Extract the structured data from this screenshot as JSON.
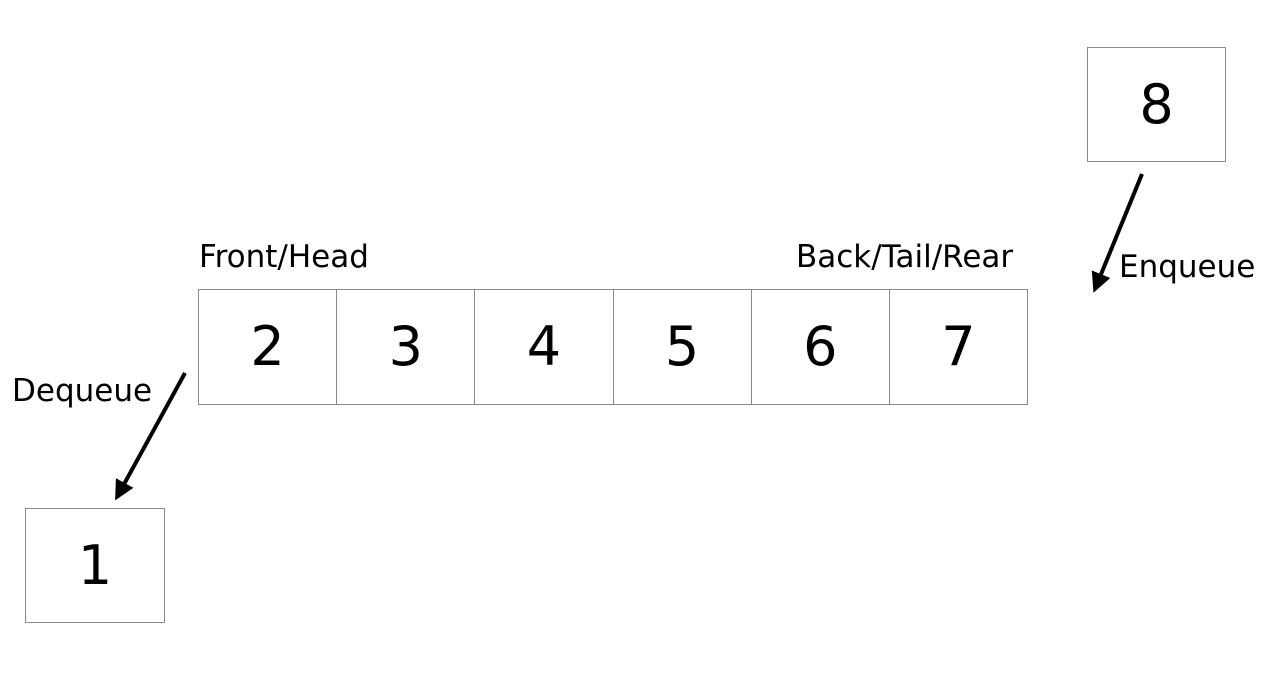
{
  "queue": {
    "front_label": "Front/Head",
    "back_label": "Back/Tail/Rear",
    "items": [
      "2",
      "3",
      "4",
      "5",
      "6",
      "7"
    ]
  },
  "dequeue": {
    "label": "Dequeue",
    "item": "1"
  },
  "enqueue": {
    "label": "Enqueue",
    "item": "8"
  }
}
